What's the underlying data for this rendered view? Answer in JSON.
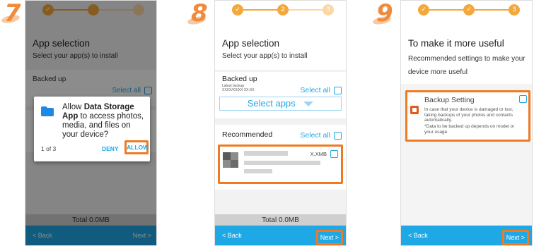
{
  "steps": [
    {
      "number": "7",
      "stepper": [
        "",
        "",
        ""
      ],
      "title": "App selection",
      "subtitle": "Select your app(s) to install",
      "backed_up_label": "Backed up",
      "select_all": "Select all",
      "dialog": {
        "prefix": "Allow ",
        "app_name": "Data Storage App",
        "suffix": " to access photos, media, and files on your device?",
        "counter": "1 of 3",
        "deny": "DENY",
        "allow": "ALLOW"
      },
      "total": "Total 0.0MB",
      "back": "< Back",
      "next": "Next >"
    },
    {
      "number": "8",
      "stepper": [
        "",
        "2",
        "3"
      ],
      "title": "App selection",
      "subtitle": "Select your app(s) to install",
      "backed_up_label": "Backed up",
      "latest_backup_label": "Latest backup",
      "latest_backup_value": "XXXX/XX/XX XX:XX",
      "select_all": "Select all",
      "select_apps": "Select apps",
      "recommended_label": "Recommended",
      "recommended_select_all": "Select all",
      "app_size": "X.XMB",
      "total": "Total 0.0MB",
      "back": "< Back",
      "next": "Next >"
    },
    {
      "number": "9",
      "stepper": [
        "",
        "",
        "3"
      ],
      "title": "To make it more useful",
      "subtitle": "Recommended settings to make your device more useful",
      "setting_title": "Backup Setting",
      "setting_desc": "In case that your device is damaged or lost, taking backups of your photos and contacts automatically.",
      "setting_note": "*Data to be backed up depends on model or your usage.",
      "back": "< Back",
      "next": "Next >"
    }
  ],
  "colors": {
    "accent_orange": "#f07a22",
    "stepper_orange": "#f4a83c",
    "blue": "#1fa8e6"
  },
  "icons": {
    "done_step": "check-icon",
    "folder": "folder-icon",
    "dropdown": "triangle-down-icon",
    "backup_app": "backup-app-icon"
  }
}
